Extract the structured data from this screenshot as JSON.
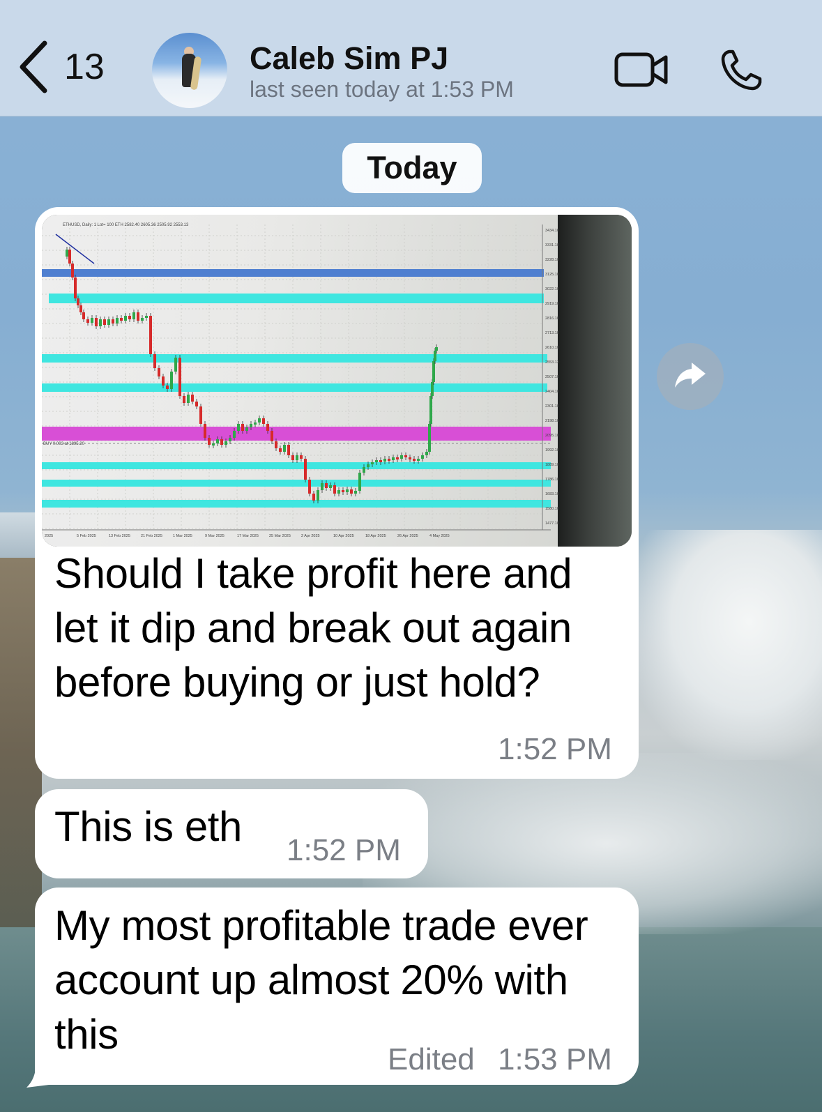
{
  "header": {
    "back_count": "13",
    "contact_name": "Caleb Sim PJ",
    "last_seen": "last seen today at 1:53 PM"
  },
  "date_chip": "Today",
  "messages": [
    {
      "text": "Should I take profit here and let it dip and break out again before buying or just hold?",
      "lines": [
        "Should I take profit here and",
        "let it dip and break out again",
        "before buying or just hold?"
      ],
      "time": "1:52 PM",
      "has_photo": true
    },
    {
      "text": "This is eth",
      "time": "1:52 PM"
    },
    {
      "text": "My most profitable trade ever account up almost 20% with this",
      "lines": [
        "My most profitable trade ever",
        "account up almost 20% with",
        "this"
      ],
      "edited_label": "Edited",
      "time": "1:53 PM"
    }
  ],
  "photo": {
    "chart_title": "ETHUSD, Daily: 1 Lot= 100 ETH 2582.40 2605.36 2505.92 2553.13",
    "order_label": "BUY 0.003 at 1895.20",
    "price_ticks": [
      "3434.10",
      "3331.10",
      "3228.10",
      "3125.10",
      "3022.10",
      "2919.10",
      "2816.10",
      "2713.10",
      "2610.10",
      "2553.13",
      "2507.10",
      "2404.10",
      "2301.10",
      "2198.10",
      "2095.10",
      "1992.10",
      "1889.10",
      "1786.10",
      "1683.10",
      "1580.10",
      "1477.10"
    ],
    "date_ticks": [
      "2025",
      "5 Feb 2025",
      "13 Feb 2025",
      "21 Feb 2025",
      "1 Mar 2025",
      "9 Mar 2025",
      "17 Mar 2025",
      "25 Mar 2025",
      "2 Apr 2025",
      "10 Apr 2025",
      "18 Apr 2025",
      "26 Apr 2025",
      "4 May 2025"
    ]
  },
  "colors": {
    "header_bg": "#cedcec",
    "bubble_bg": "#ffffff",
    "time_gray": "#7b7f86",
    "zone_blue": "#4f7fd0",
    "zone_cyan": "#3fe6e0",
    "zone_magenta": "#d84fd6",
    "candle_up": "#2fa84a",
    "candle_down": "#d62a2a"
  },
  "icons": [
    "chevron-left-icon",
    "video-icon",
    "phone-icon",
    "forward-icon"
  ]
}
